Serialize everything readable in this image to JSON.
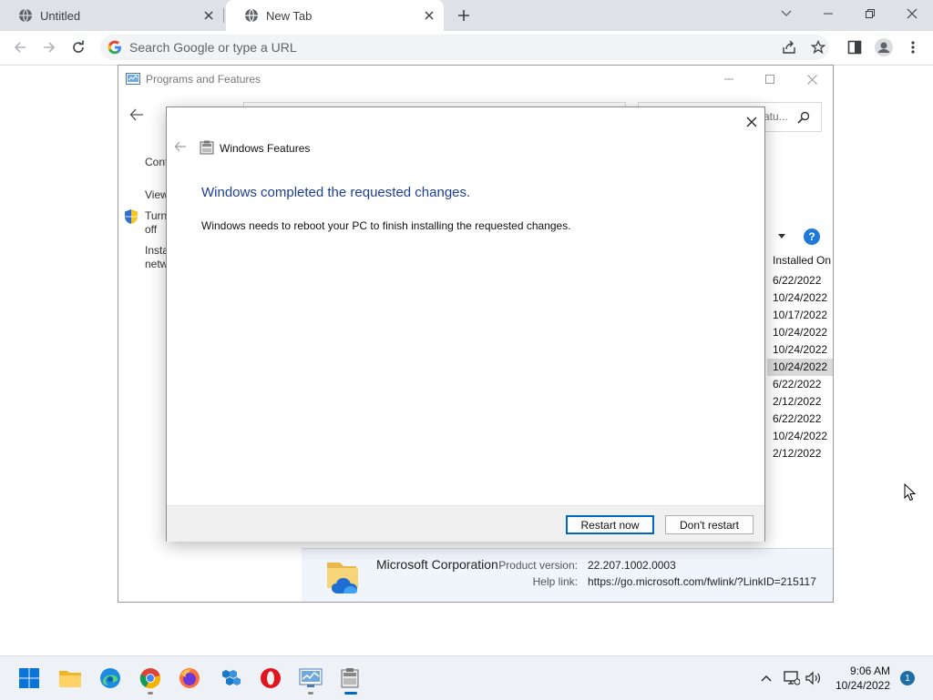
{
  "browser": {
    "tabs": [
      {
        "title": "Untitled",
        "icon": "globe-icon",
        "active": false
      },
      {
        "title": "New Tab",
        "icon": "globe-icon",
        "active": true
      }
    ],
    "omnibox_placeholder": "Search Google or type a URL"
  },
  "programs_and_features": {
    "title": "Programs and Features",
    "search_partial": "atu...",
    "sidebar": [
      "Cont",
      "View",
      "Turn\noff",
      "Insta\nnetw"
    ],
    "installed_on_header": "Installed On",
    "installed_on": [
      "6/22/2022",
      "10/24/2022",
      "10/17/2022",
      "10/24/2022",
      "10/24/2022",
      "10/24/2022",
      "6/22/2022",
      "2/12/2022",
      "6/22/2022",
      "10/24/2022",
      "2/12/2022"
    ],
    "selected_row_index": 5,
    "details": {
      "publisher": "Microsoft Corporation",
      "product_version_label": "Product version:",
      "product_version": "22.207.1002.0003",
      "help_link_label": "Help link:",
      "help_link": "https://go.microsoft.com/fwlink/?LinkID=215117"
    }
  },
  "windows_features_dialog": {
    "title": "Windows Features",
    "heading": "Windows completed the requested changes.",
    "message": "Windows needs to reboot your PC to finish installing the requested changes.",
    "restart_now_label": "Restart now",
    "dont_restart_label": "Don't restart"
  },
  "taskbar": {
    "apps": [
      "start-icon",
      "file-explorer-icon",
      "edge-icon",
      "chrome-icon",
      "firefox-icon",
      "app-icon",
      "opera-icon",
      "control-panel-icon",
      "windows-features-icon"
    ],
    "time": "9:06 AM",
    "date": "10/24/2022",
    "notification_count": "1"
  },
  "colors": {
    "dialog_heading": "#1c3f94",
    "accent": "#0067c0"
  }
}
